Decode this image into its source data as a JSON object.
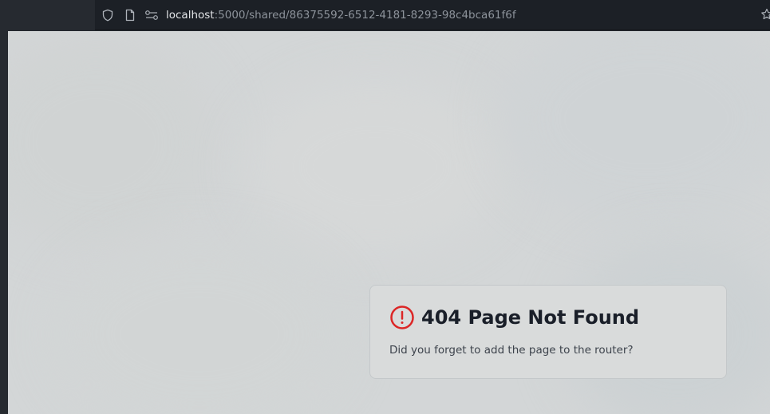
{
  "browser": {
    "url_host": "localhost",
    "url_rest": ":5000/shared/86375592-6512-4181-8293-98c4bca61f6f",
    "icons": {
      "shield": "shield-icon",
      "page": "page-icon",
      "permissions": "permissions-icon",
      "bookmark": "star-icon"
    }
  },
  "page": {
    "title": "404 Page Not Found",
    "message": "Did you forget to add the page to the router?",
    "alert_icon": "alert-circle-icon",
    "accent_color": "#dc2626"
  }
}
